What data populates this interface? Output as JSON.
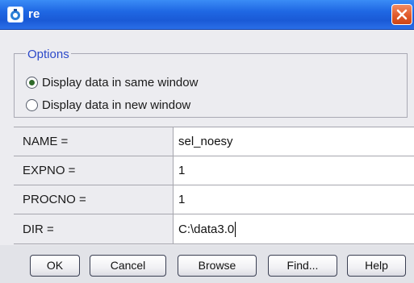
{
  "window": {
    "title": "re",
    "icon": "app-icon",
    "close_icon": "close-icon",
    "close_color": "#e15a2b",
    "titlebar_color": "#1f67e3"
  },
  "options": {
    "legend": "Options",
    "legend_color": "#2c49c9",
    "radios": [
      {
        "label": "Display data in same window",
        "checked": true
      },
      {
        "label": "Display data in new window",
        "checked": false
      }
    ]
  },
  "form": {
    "fields": [
      {
        "label": "NAME =",
        "value": "sel_noesy"
      },
      {
        "label": "EXPNO =",
        "value": "1"
      },
      {
        "label": "PROCNO =",
        "value": "1"
      },
      {
        "label": "DIR =",
        "value": "C:\\data3.0"
      }
    ]
  },
  "buttons": {
    "ok": "OK",
    "cancel": "Cancel",
    "browse": "Browse",
    "find": "Find...",
    "help": "Help"
  }
}
